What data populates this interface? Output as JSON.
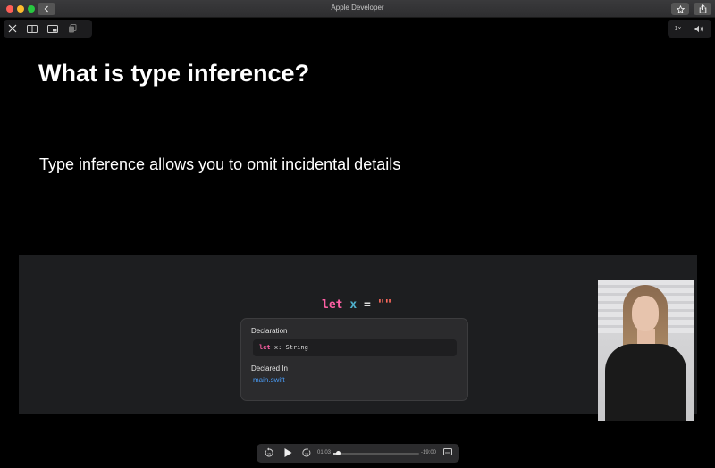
{
  "window": {
    "title": "Apple Developer"
  },
  "player": {
    "speed_label": "1×",
    "current_time": "01:03",
    "remaining_time": "-19:00",
    "progress_fraction": 0.05
  },
  "slide": {
    "title": "What is type inference?",
    "subtitle": "Type inference allows you to omit incidental details"
  },
  "code": {
    "keyword": "let",
    "variable": "x",
    "operator": "=",
    "literal": "\"\""
  },
  "popover": {
    "declaration_heading": "Declaration",
    "declaration_keyword": "let",
    "declaration_rest": " x: String",
    "declared_in_heading": "Declared In",
    "file_link": "main.swift"
  },
  "colors": {
    "keyword": "#fc5fa3",
    "variable": "#4eb0cc",
    "string": "#fc6a5d",
    "link": "#4a9df8"
  }
}
